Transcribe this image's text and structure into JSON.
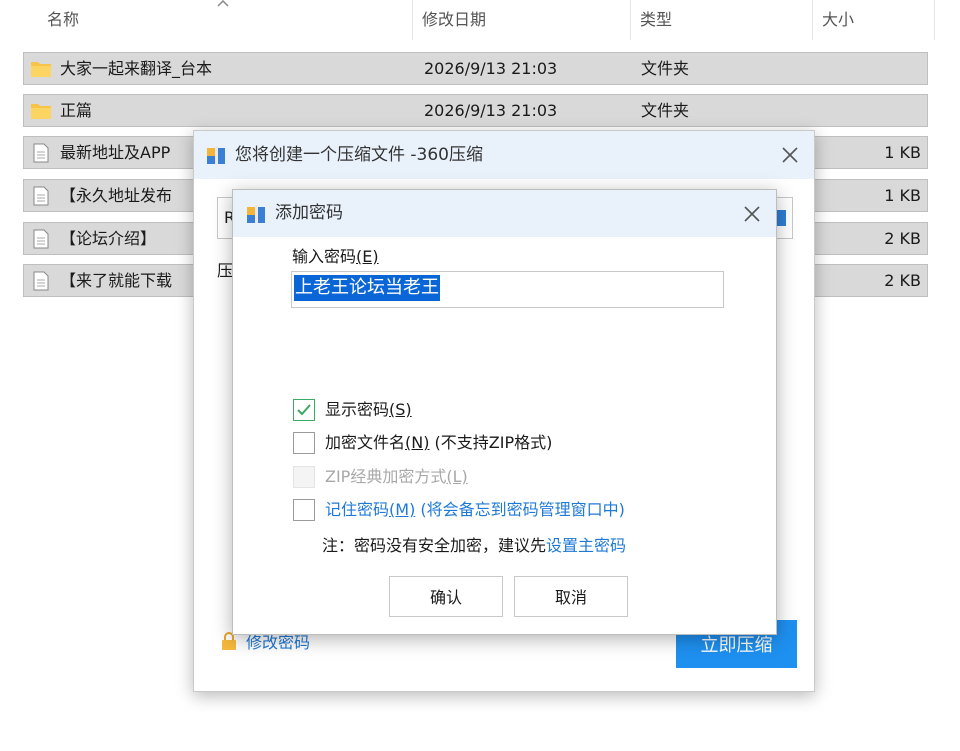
{
  "explorer": {
    "columns": {
      "name": "名称",
      "modified": "修改日期",
      "type": "类型",
      "size": "大小"
    },
    "rows": [
      {
        "icon": "folder-icon",
        "name": "大家一起来翻译_台本",
        "modified": "2026/9/13 21:03",
        "type": "文件夹",
        "size": ""
      },
      {
        "icon": "folder-icon",
        "name": "正篇",
        "modified": "2026/9/13 21:03",
        "type": "文件夹",
        "size": ""
      },
      {
        "icon": "file-icon",
        "name": "最新地址及APP",
        "modified": "",
        "type": "",
        "size": "1 KB"
      },
      {
        "icon": "file-icon",
        "name": "【永久地址发布",
        "modified": "",
        "type": "",
        "size": "1 KB"
      },
      {
        "icon": "file-icon",
        "name": "【论坛介绍】",
        "modified": "",
        "type": "",
        "size": "2 KB"
      },
      {
        "icon": "file-icon",
        "name": "【来了就能下载",
        "modified": "",
        "type": "",
        "size": "2 KB"
      }
    ]
  },
  "compress_dialog": {
    "title": "您将创建一个压缩文件 -360压缩",
    "path_partial": "R",
    "label_partial": "压",
    "change_password": "修改密码",
    "compress_now": "立即压缩"
  },
  "password_dialog": {
    "title": "添加密码",
    "input_label": "输入密码",
    "input_label_key": "(E)",
    "password_value": "上老王论坛当老王",
    "options": [
      {
        "label": "显示密码",
        "key": "(S)",
        "suffix": "",
        "checked": true,
        "disabled": false
      },
      {
        "label": "加密文件名",
        "key": "(N)",
        "suffix": " (不支持ZIP格式)",
        "checked": false,
        "disabled": false
      },
      {
        "label": "ZIP经典加密方式",
        "key": "(L)",
        "suffix": "",
        "checked": false,
        "disabled": true
      },
      {
        "label": "记住密码",
        "key": "(M)",
        "suffix": " (将会备忘到密码管理窗口中)",
        "checked": false,
        "disabled": false
      }
    ],
    "note_prefix": "注：密码没有安全加密，建议先",
    "note_link": "设置主密码",
    "ok": "确认",
    "cancel": "取消"
  },
  "colors": {
    "accent": "#1e90f0",
    "link": "#1f7ad6",
    "selection": "#0a66d6",
    "check": "#3aaa64",
    "folder": "#f8c447"
  }
}
